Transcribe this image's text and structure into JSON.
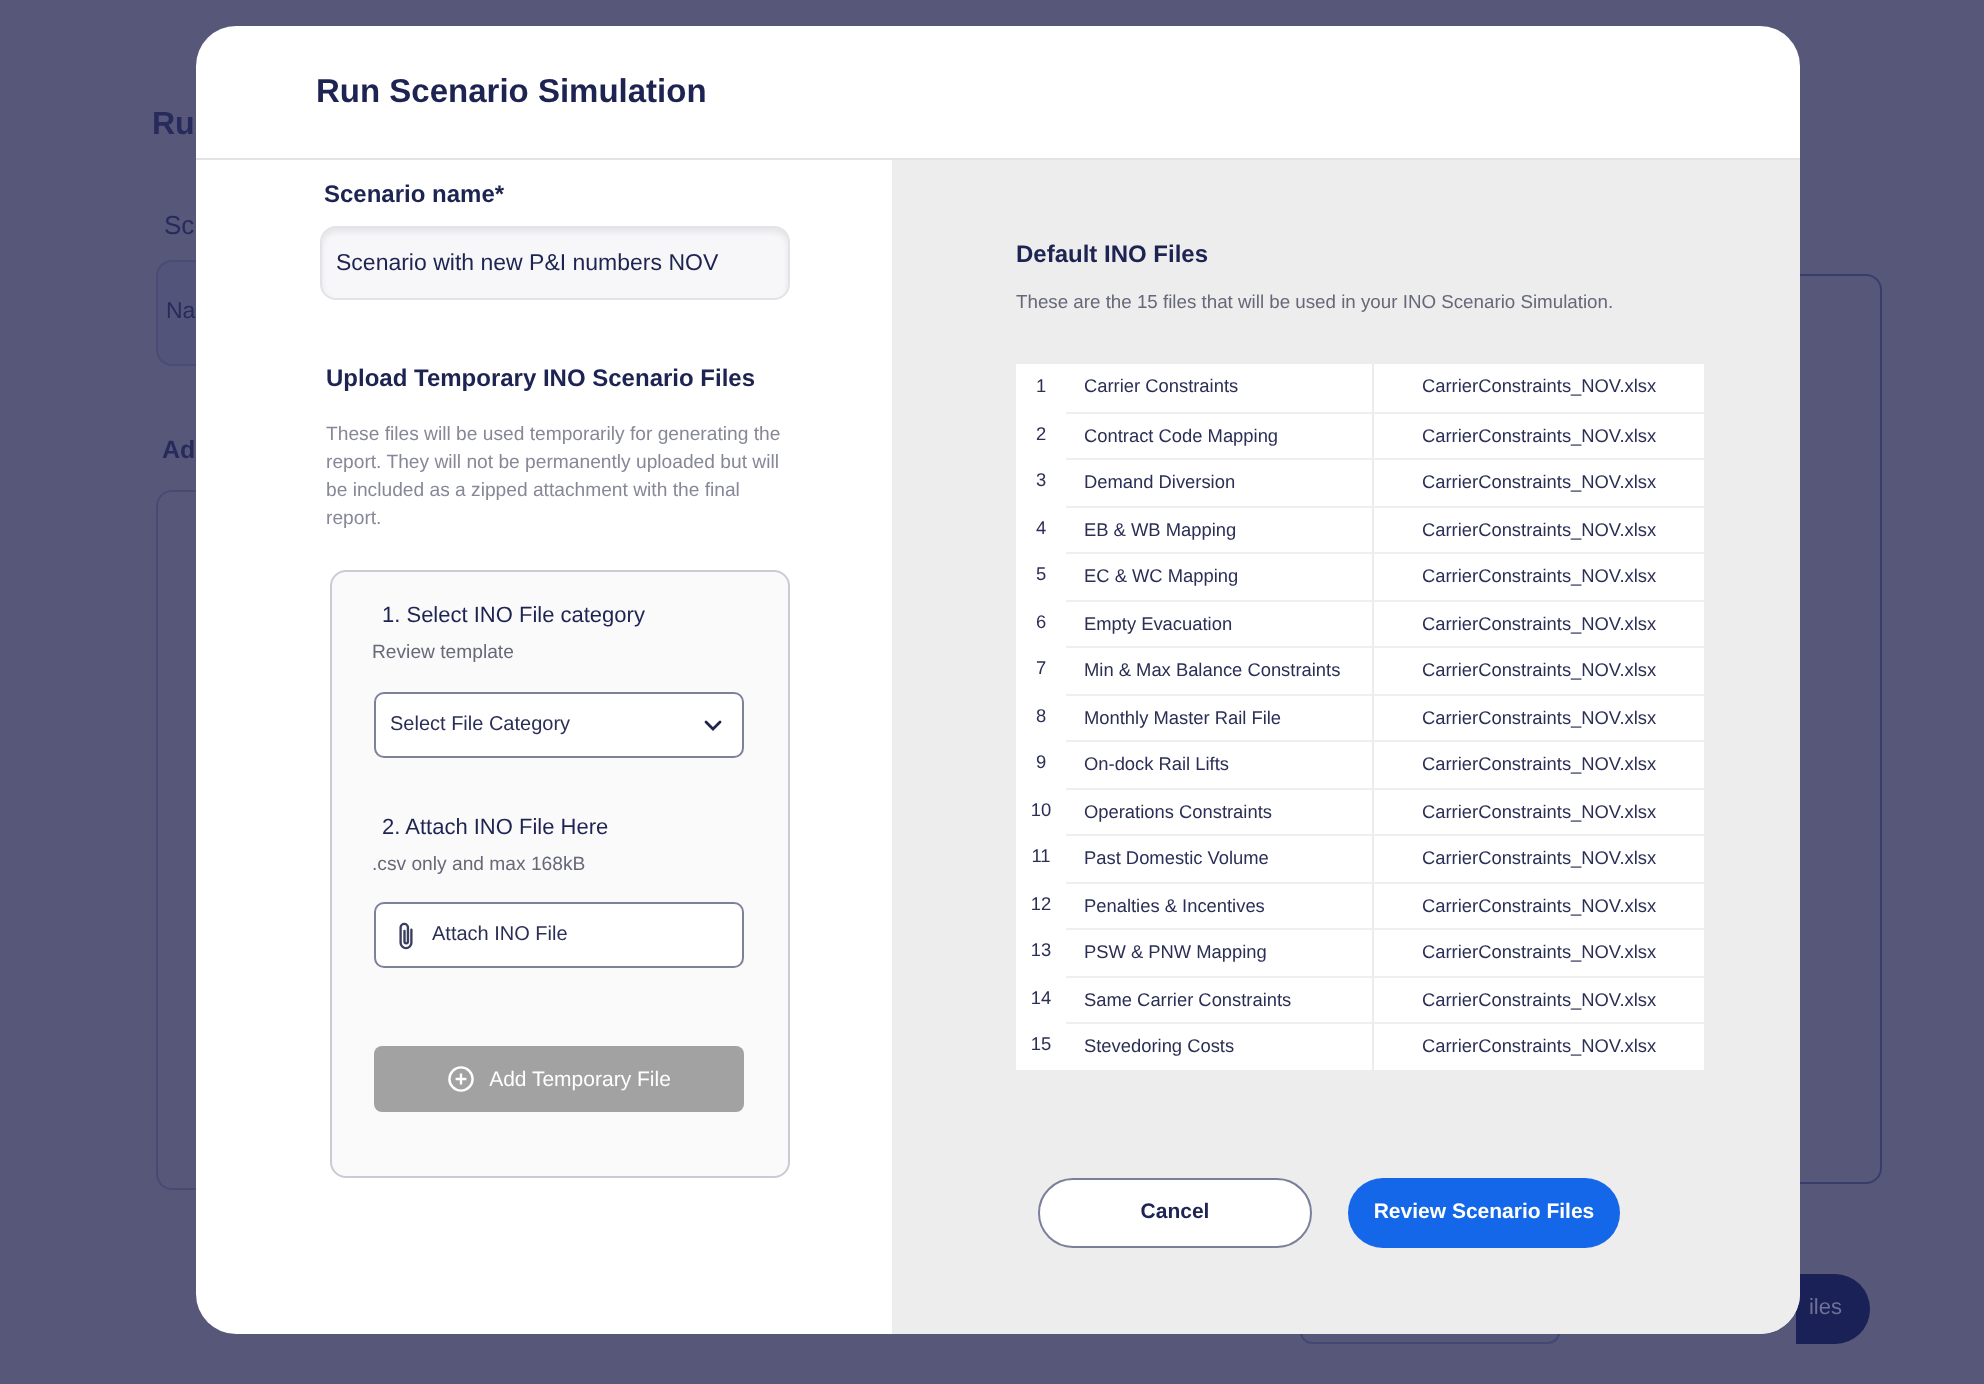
{
  "background_page": {
    "title": "Ru",
    "field_label": "Sc",
    "field_text": "Na",
    "section_title": "Ad",
    "button_label": "iles"
  },
  "dialog": {
    "title": "Run Scenario Simulation"
  },
  "scenario_name": {
    "label": "Scenario name*",
    "value": "Scenario with new P&I numbers NOV"
  },
  "temporary_files": {
    "heading": "Upload Temporary INO Scenario Files",
    "description": "These files will be used temporarily for generating the report. They will not be permanently uploaded but will be included as a zipped attachment with the final report.",
    "steps": [
      {
        "kind": "select",
        "title": "1. Select INO File category",
        "note": "Review template",
        "placeholder": "Select File Category"
      },
      {
        "kind": "attach",
        "title": "2. Attach INO File Here",
        "note": ".csv only and max 168kB",
        "label": "Attach INO File"
      }
    ],
    "add_button": {
      "label": "Add Temporary File",
      "disabled": true
    }
  },
  "default_files": {
    "heading": "Default INO Files",
    "description": "These are the 15 files that will be used in your INO Scenario Simulation.",
    "rows": [
      {
        "number": "1",
        "category": "Carrier Constraints",
        "file": "CarrierConstraints_NOV.xlsx"
      },
      {
        "number": "2",
        "category": "Contract Code Mapping",
        "file": "CarrierConstraints_NOV.xlsx"
      },
      {
        "number": "3",
        "category": "Demand Diversion",
        "file": "CarrierConstraints_NOV.xlsx"
      },
      {
        "number": "4",
        "category": "EB & WB Mapping",
        "file": "CarrierConstraints_NOV.xlsx"
      },
      {
        "number": "5",
        "category": "EC & WC Mapping",
        "file": "CarrierConstraints_NOV.xlsx"
      },
      {
        "number": "6",
        "category": "Empty Evacuation",
        "file": "CarrierConstraints_NOV.xlsx"
      },
      {
        "number": "7",
        "category": "Min & Max Balance Constraints",
        "file": "CarrierConstraints_NOV.xlsx"
      },
      {
        "number": "8",
        "category": "Monthly Master Rail File",
        "file": "CarrierConstraints_NOV.xlsx"
      },
      {
        "number": "9",
        "category": "On-dock Rail Lifts",
        "file": "CarrierConstraints_NOV.xlsx"
      },
      {
        "number": "10",
        "category": "Operations Constraints",
        "file": "CarrierConstraints_NOV.xlsx"
      },
      {
        "number": "11",
        "category": "Past Domestic Volume",
        "file": "CarrierConstraints_NOV.xlsx"
      },
      {
        "number": "12",
        "category": "Penalties & Incentives",
        "file": "CarrierConstraints_NOV.xlsx"
      },
      {
        "number": "13",
        "category": "PSW & PNW Mapping",
        "file": "CarrierConstraints_NOV.xlsx"
      },
      {
        "number": "14",
        "category": "Same Carrier Constraints",
        "file": "CarrierConstraints_NOV.xlsx"
      },
      {
        "number": "15",
        "category": "Stevedoring Costs",
        "file": "CarrierConstraints_NOV.xlsx"
      }
    ]
  },
  "buttons": [
    {
      "label": "Cancel",
      "kind": "secondary"
    },
    {
      "label": "Review Scenario Files",
      "kind": "primary"
    }
  ]
}
